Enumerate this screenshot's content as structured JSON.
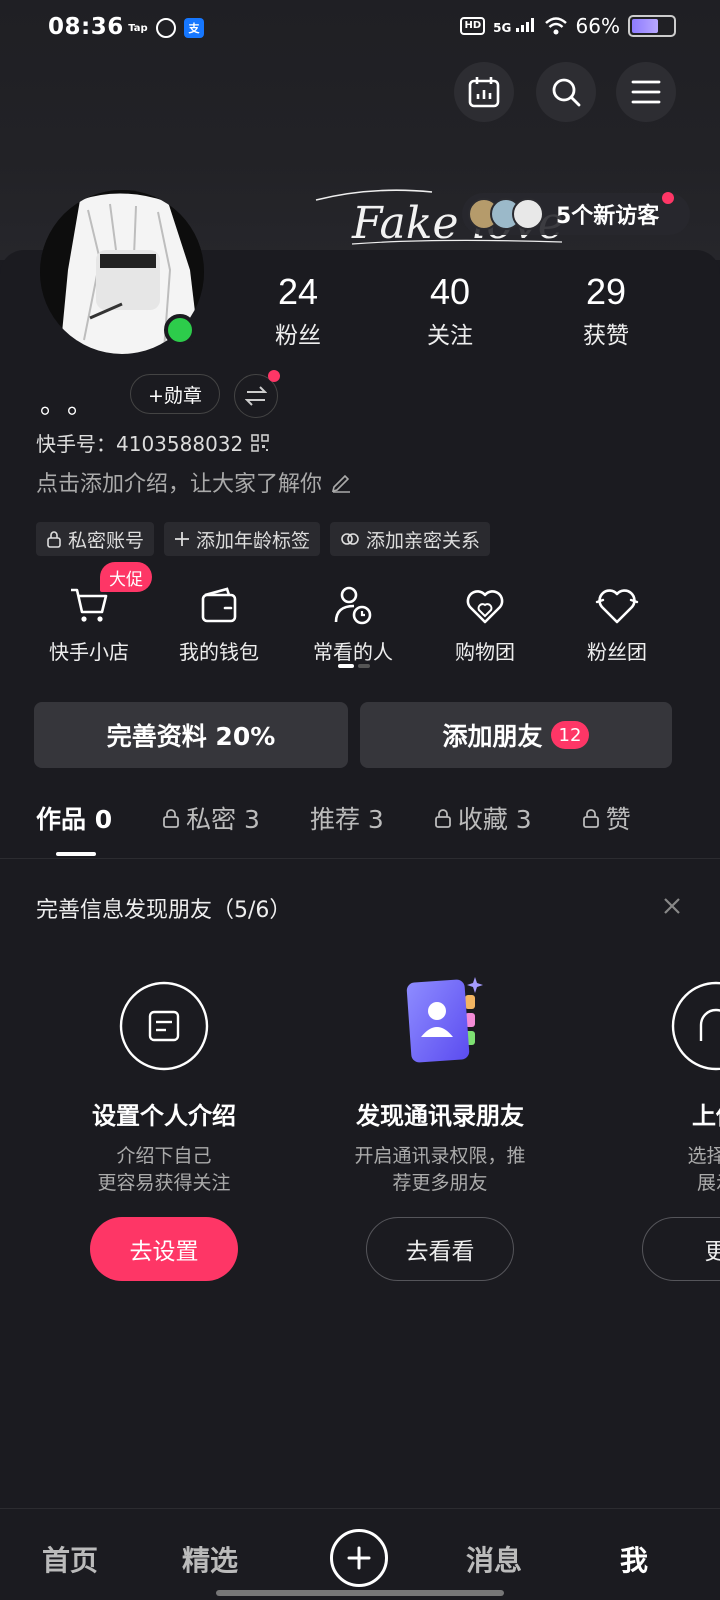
{
  "status_bar": {
    "time": "08:36",
    "app_icons": [
      "Tap",
      "",
      "支"
    ],
    "hd": "HD",
    "network": "5G",
    "battery_percent": "66%",
    "battery_level": 0.66
  },
  "header": {
    "signature": "Fake love",
    "visitors_text": "5个新访客"
  },
  "profile": {
    "nickname": "。。",
    "medal_label": "+勋章",
    "ks_id": "快手号：4103588032",
    "bio": "点击添加介绍，让大家了解你",
    "stats": [
      {
        "num": "24",
        "label": "粉丝"
      },
      {
        "num": "40",
        "label": "关注"
      },
      {
        "num": "29",
        "label": "获赞"
      }
    ],
    "tags": [
      "私密账号",
      "添加年龄标签",
      "添加亲密关系"
    ]
  },
  "functions": {
    "items": [
      "快手小店",
      "我的钱包",
      "常看的人",
      "购物团",
      "粉丝团"
    ],
    "promo_badge": "大促"
  },
  "actions": {
    "complete_profile": "完善资料 20%",
    "add_friends": "添加朋友",
    "add_friends_count": "12"
  },
  "tabs": [
    {
      "label": "作品 0",
      "locked": false
    },
    {
      "label": "私密 3",
      "locked": true
    },
    {
      "label": "推荐 3",
      "locked": false
    },
    {
      "label": "收藏 3",
      "locked": true
    },
    {
      "label": "赞",
      "locked": true
    }
  ],
  "friend_finder": {
    "title": "完善信息发现朋友（5/6）",
    "cards": [
      {
        "title": "设置个人介绍",
        "desc": "介绍下自己\n更容易获得关注",
        "button": "去设置"
      },
      {
        "title": "发现通讯录朋友",
        "desc": "开启通讯录权限，推\n荐更多朋友",
        "button": "去看看"
      },
      {
        "title": "上传",
        "desc": "选择喜\n展示",
        "button": "更"
      }
    ]
  },
  "bottom_nav": {
    "home": "首页",
    "featured": "精选",
    "messages": "消息",
    "me": "我"
  }
}
